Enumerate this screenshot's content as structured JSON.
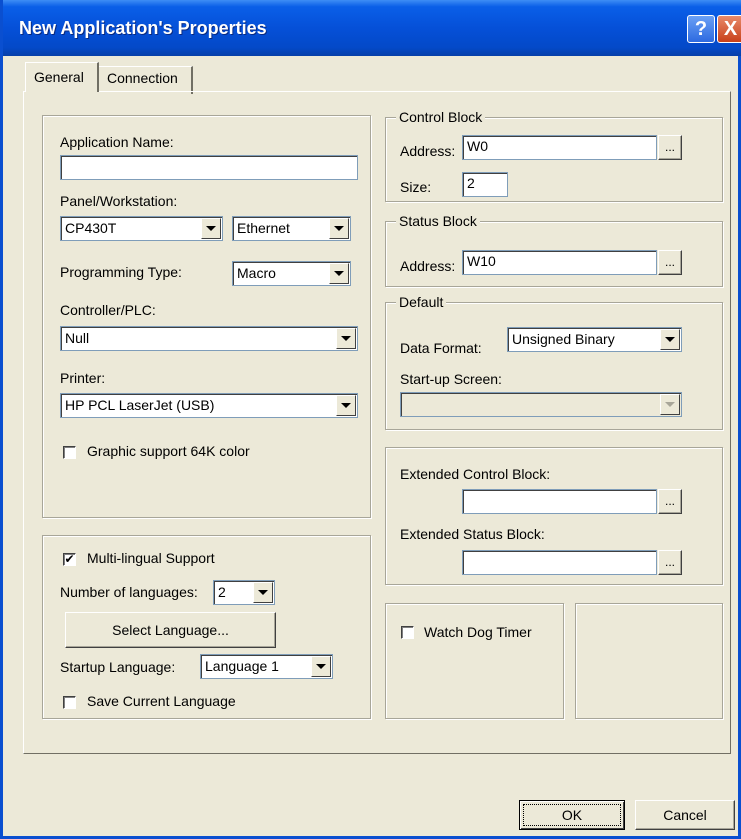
{
  "window": {
    "title": "New Application's Properties",
    "help_glyph": "?",
    "close_glyph": "X"
  },
  "tabs": [
    {
      "label": "General"
    },
    {
      "label": "Connection"
    }
  ],
  "general": {
    "app_name_label": "Application Name:",
    "app_name_value": "",
    "panel_label": "Panel/Workstation:",
    "panel_value": "CP430T",
    "panel_conn_value": "Ethernet",
    "programming_type_label": "Programming Type:",
    "programming_type_value": "Macro",
    "controller_label": "Controller/PLC:",
    "controller_value": "Null",
    "printer_label": "Printer:",
    "printer_value": "HP PCL LaserJet (USB)",
    "graphic_support_label": "Graphic support 64K color",
    "graphic_support_checked": false
  },
  "language": {
    "multilingual_label": "Multi-lingual Support",
    "multilingual_check": "✔",
    "num_languages_label": "Number of languages:",
    "num_languages_value": "2",
    "select_language_button": "Select Language...",
    "startup_language_label": "Startup Language:",
    "startup_language_value": "Language 1",
    "save_current_label": "Save Current Language",
    "save_current_checked": false
  },
  "control_block": {
    "title": "Control Block",
    "address_label": "Address:",
    "address_value": "W0",
    "size_label": "Size:",
    "size_value": "2",
    "browse_label": "..."
  },
  "status_block": {
    "title": "Status Block",
    "address_label": "Address:",
    "address_value": "W10",
    "browse_label": "..."
  },
  "default": {
    "title": "Default",
    "data_format_label": "Data Format:",
    "data_format_value": "Unsigned Binary",
    "startup_screen_label": "Start-up Screen:",
    "startup_screen_value": ""
  },
  "extended": {
    "control_label": "Extended Control Block:",
    "control_value": "",
    "status_label": "Extended Status Block:",
    "status_value": "",
    "browse_label": "..."
  },
  "watchdog": {
    "label": "Watch Dog Timer",
    "checked": false
  },
  "footer": {
    "ok_label": "OK",
    "cancel_label": "Cancel"
  },
  "colors": {
    "titlebar": "#0550d8",
    "dialog_bg": "#ece9d8",
    "field_border": "#7f9db9"
  }
}
